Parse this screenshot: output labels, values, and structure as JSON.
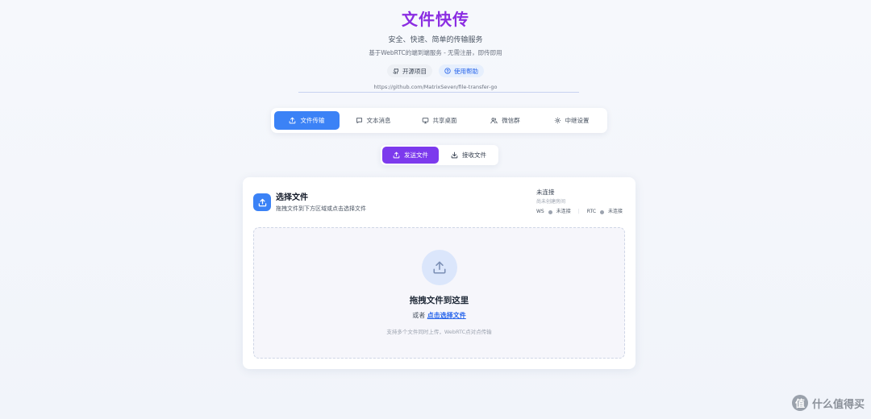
{
  "header": {
    "title": "文件快传",
    "subtitle": "安全、快速、简单的传输服务",
    "description": "基于WebRTC的端到端服务 - 无需注册，即传即用",
    "pills": [
      {
        "label": "开源项目",
        "icon": "github-icon"
      },
      {
        "label": "使用帮助",
        "icon": "help-circle-icon"
      }
    ],
    "repo_url": "https://github.com/MatrixSeven/file-transfer-go"
  },
  "nav": {
    "items": [
      {
        "label": "文件传输",
        "icon": "upload-icon",
        "active": true
      },
      {
        "label": "文本消息",
        "icon": "message-icon",
        "active": false
      },
      {
        "label": "共享桌面",
        "icon": "monitor-icon",
        "active": false
      },
      {
        "label": "微信群",
        "icon": "users-icon",
        "active": false
      },
      {
        "label": "中继设置",
        "icon": "gear-icon",
        "active": false
      }
    ]
  },
  "mode": {
    "send_label": "发送文件",
    "receive_label": "接收文件",
    "active": "send"
  },
  "card": {
    "title": "选择文件",
    "subtitle": "拖拽文件到下方区域或点击选择文件",
    "status": {
      "main": "未连接",
      "room": "尚未创建房间",
      "ws_label": "WS",
      "ws_state": "未连接",
      "rtc_label": "RTC",
      "rtc_state": "未连接",
      "separator": "|"
    }
  },
  "dropzone": {
    "title": "拖拽文件到这里",
    "or_text": "或者",
    "link_text": "点击选择文件",
    "hint": "支持多个文件同时上传，WebRTC点对点传输"
  },
  "watermark": {
    "symbol": "值",
    "text": "什么值得买"
  },
  "colors": {
    "brand_purple": "#8b2de2",
    "accent_blue": "#3b82f6",
    "send_purple": "#7c3aed",
    "status_dot": "#9ca3af"
  }
}
